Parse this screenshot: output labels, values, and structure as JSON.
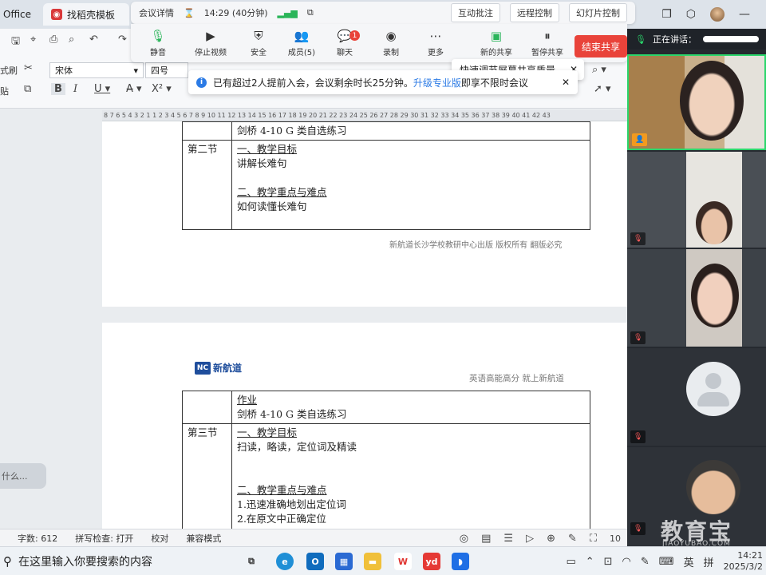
{
  "tabs": {
    "office": "Office",
    "templates": "找稻壳模板"
  },
  "meeting": {
    "details": "会议详情",
    "time": "14:29 (40分钟)",
    "interactive_annotate": "互动批注",
    "remote_control": "远程控制",
    "slide_control": "幻灯片控制",
    "toolbar": [
      {
        "label": "静音",
        "icon": "microphone-icon"
      },
      {
        "label": "停止视频",
        "icon": "video-camera-icon"
      },
      {
        "label": "安全",
        "icon": "shield-icon"
      },
      {
        "label": "成员(5)",
        "icon": "members-icon"
      },
      {
        "label": "聊天",
        "icon": "chat-icon",
        "badge": "1"
      },
      {
        "label": "录制",
        "icon": "record-icon"
      },
      {
        "label": "更多",
        "icon": "more-icon"
      },
      {
        "label": "新的共享",
        "icon": "new-share-icon"
      },
      {
        "label": "暂停共享",
        "icon": "pause-share-icon"
      }
    ],
    "end_share": "结束共享",
    "quality_tip": "快速调节屏幕共享质量",
    "notice_text": "已有超过2人提前入会，会议剩余时长25分钟。",
    "notice_link": "升级专业版",
    "notice_suffix": "即享不限时会议",
    "speaking": "正在讲话："
  },
  "ribbon": {
    "format_brush": "式刷",
    "paste": "贴",
    "font_name": "宋体",
    "font_size": "四号"
  },
  "ruler": "8 7 6 5 4 3 2 1   1 2 3 4 5 6 7 8 9 10 11 12 13 14 15 16 17 18 19 20 21 22 23 24 25 26 27 28 29 30 31 32 33 34 35 36 37 38 39 40 41 42 43",
  "document": {
    "page1": {
      "top_row": "剑桥 4-10 G 类自选练习",
      "section": "第二节",
      "goal_title": "一、教学目标",
      "goal_text": "讲解长难句",
      "focus_title": "二、教学重点与难点",
      "focus_text": "如何读懂长难句",
      "footer": "新航道长沙学校教研中心出版  版权所有   翻版必究"
    },
    "page2": {
      "logo_text": "新航道",
      "logo_sub": "NC",
      "header_right": "英语高能高分   就上新航道",
      "homework_title": "作业",
      "homework_text": "剑桥 4-10 G 类自选练习",
      "section": "第三节",
      "goal_title": "一、教学目标",
      "goal_text": "扫读，略读，定位词及精读",
      "focus_title": "二、教学重点与难点",
      "focus_items": [
        "1.迅速准确地划出定位词",
        "2.在原文中正确定位"
      ]
    }
  },
  "chat_bubble": "什么...",
  "statusbar": {
    "word_count": "字数: 612",
    "spell_check": "拼写检查: 打开",
    "proofread": "校对",
    "compat_mode": "兼容模式",
    "zoom": "10"
  },
  "taskbar": {
    "search_placeholder": "在这里输入你要搜索的内容",
    "ime_lang": "英",
    "ime_mode": "拼",
    "time": "14:21",
    "date": "2025/3/2"
  },
  "watermark": {
    "main": "教育宝",
    "sub": "JIAOYUBAO.COM"
  },
  "colors": {
    "accent_red": "#e9433a",
    "link_blue": "#2c7be5",
    "speaking_green": "#2bd66b",
    "panel_dark": "#262a30"
  }
}
